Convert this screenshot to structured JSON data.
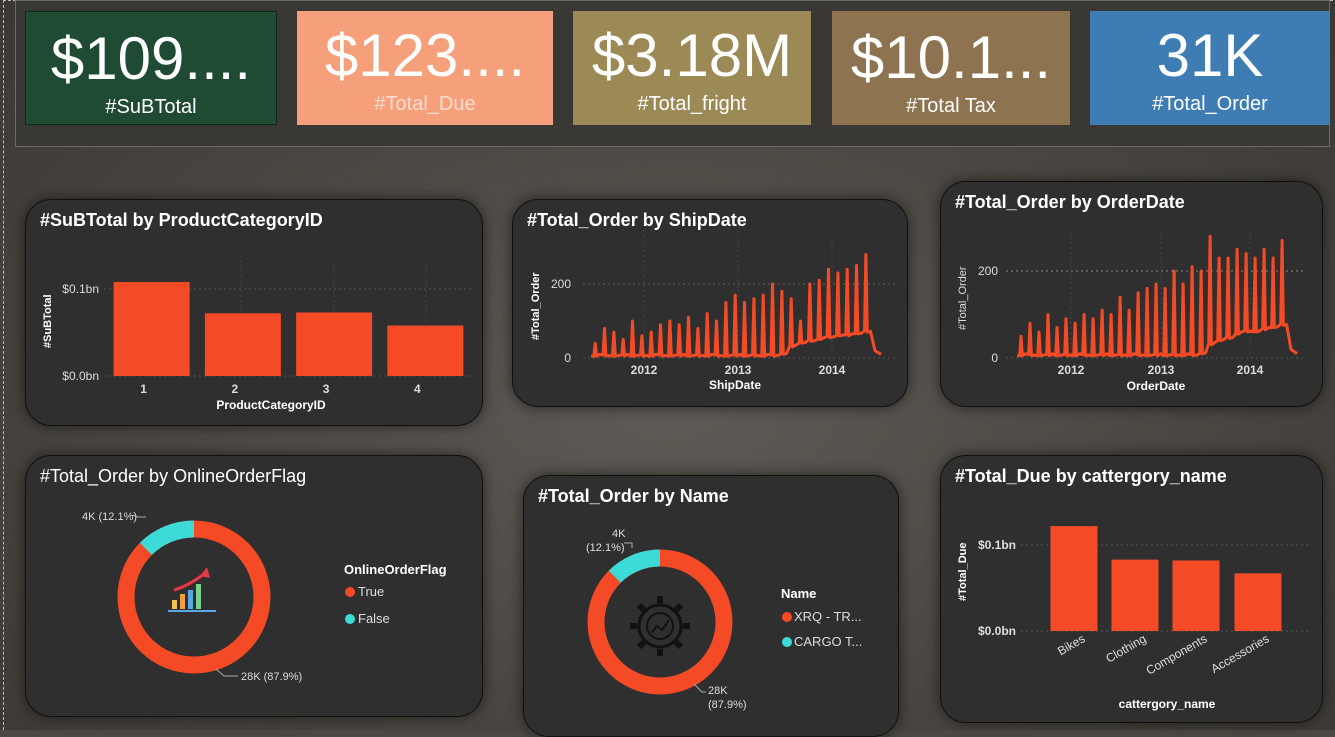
{
  "kpis": [
    {
      "value": "$109....",
      "label": "#SuBTotal",
      "color": "#1f4b33"
    },
    {
      "value": "$123....",
      "label": "#Total_Due",
      "color": "#f5a07a"
    },
    {
      "value": "$3.18M",
      "label": "#Total_fright",
      "color": "#9b8a55"
    },
    {
      "value": "$10.1...",
      "label": "#Total Tax",
      "color": "#8e7350"
    },
    {
      "value": "31K",
      "label": "#Total_Order",
      "color": "#3d7db3"
    }
  ],
  "colors": {
    "series": "#f44b26",
    "secondary": "#3ddbd8",
    "panel": "#2f2f2f"
  },
  "charts": {
    "subtotal_by_cat": {
      "title": "#SuBTotal by ProductCategoryID",
      "xlabel": "ProductCategoryID",
      "ylabel": "#SuBTotal",
      "yticks": [
        "$0.0bn",
        "$0.1bn"
      ]
    },
    "order_by_shipdate": {
      "title": "#Total_Order by ShipDate",
      "xlabel": "ShipDate",
      "ylabel": "#Total_Order",
      "yticks": [
        "0",
        "200"
      ],
      "xticks": [
        "2012",
        "2013",
        "2014"
      ]
    },
    "order_by_orderdate": {
      "title": "#Total_Order by OrderDate",
      "xlabel": "OrderDate",
      "ylabel": "#Total_Order",
      "yticks": [
        "0",
        "200"
      ],
      "xticks": [
        "2012",
        "2013",
        "2014"
      ]
    },
    "order_by_flag": {
      "title": "#Total_Order by OnlineOrderFlag",
      "legend_title": "OnlineOrderFlag",
      "legend": [
        "True",
        "False"
      ],
      "label_small": "4K (12.1%)",
      "label_large": "28K (87.9%)",
      "icon": "bar-chart-growth-icon"
    },
    "order_by_name": {
      "title": "#Total_Order by Name",
      "legend_title": "Name",
      "legend": [
        "XRQ - TR...",
        "CARGO T..."
      ],
      "label_small_1": "4K",
      "label_small_2": "(12.1%)",
      "label_large_1": "28K",
      "label_large_2": "(87.9%)",
      "icon": "gear-analytics-icon"
    },
    "due_by_category": {
      "title": "#Total_Due by cattergory_name",
      "xlabel": "cattergory_name",
      "ylabel": "#Total_Due",
      "yticks": [
        "$0.0bn",
        "$0.1bn"
      ],
      "categories": [
        "Bikes",
        "Clothing",
        "Components",
        "Accessories"
      ]
    }
  },
  "chart_data": [
    {
      "type": "bar",
      "title": "#SuBTotal by ProductCategoryID",
      "categories": [
        "1",
        "2",
        "3",
        "4"
      ],
      "values": [
        0.108,
        0.072,
        0.073,
        0.058
      ],
      "unit": "bn",
      "xlabel": "ProductCategoryID",
      "ylabel": "#SuBTotal",
      "ylim": [
        0,
        0.12
      ]
    },
    {
      "type": "line",
      "title": "#Total_Order by ShipDate",
      "xlabel": "ShipDate",
      "ylabel": "#Total_Order",
      "x_range": [
        "2011-06",
        "2014-07"
      ],
      "ylim": [
        0,
        270
      ],
      "spike_heights": [
        40,
        80,
        70,
        50,
        100,
        60,
        70,
        90,
        100,
        90,
        110,
        80,
        120,
        100,
        150,
        170,
        150,
        160,
        170,
        200,
        180,
        160,
        100,
        200,
        210,
        240,
        230,
        240,
        250,
        280
      ],
      "baseline": [
        5,
        5,
        5,
        5,
        5,
        5,
        5,
        5,
        5,
        5,
        5,
        5,
        5,
        5,
        5,
        5,
        5,
        5,
        5,
        5,
        10,
        30,
        40,
        45,
        50,
        55,
        60,
        60,
        65,
        70
      ]
    },
    {
      "type": "line",
      "title": "#Total_Order by OrderDate",
      "xlabel": "OrderDate",
      "ylabel": "#Total_Order",
      "x_range": [
        "2011-06",
        "2014-07"
      ],
      "ylim": [
        0,
        270
      ],
      "spike_heights": [
        50,
        80,
        60,
        100,
        70,
        90,
        80,
        100,
        90,
        110,
        100,
        140,
        110,
        150,
        160,
        170,
        160,
        200,
        170,
        210,
        200,
        280,
        230,
        230,
        250,
        240,
        230,
        250,
        230,
        270
      ],
      "baseline": [
        5,
        5,
        5,
        5,
        5,
        5,
        5,
        5,
        5,
        5,
        5,
        5,
        5,
        5,
        5,
        5,
        5,
        5,
        5,
        5,
        10,
        30,
        40,
        45,
        55,
        60,
        60,
        65,
        70,
        75
      ]
    },
    {
      "type": "pie",
      "title": "#Total_Order by OnlineOrderFlag",
      "labels": [
        "True",
        "False"
      ],
      "values": [
        28000,
        4000
      ],
      "percent": [
        87.9,
        12.1
      ]
    },
    {
      "type": "pie",
      "title": "#Total_Order by Name",
      "labels": [
        "XRQ - TR...",
        "CARGO T..."
      ],
      "values": [
        28000,
        4000
      ],
      "percent": [
        87.9,
        12.1
      ]
    },
    {
      "type": "bar",
      "title": "#Total_Due by cattergory_name",
      "categories": [
        "Bikes",
        "Clothing",
        "Components",
        "Accessories"
      ],
      "values": [
        0.122,
        0.083,
        0.082,
        0.067
      ],
      "unit": "bn",
      "xlabel": "cattergory_name",
      "ylabel": "#Total_Due",
      "ylim": [
        0,
        0.13
      ]
    }
  ]
}
